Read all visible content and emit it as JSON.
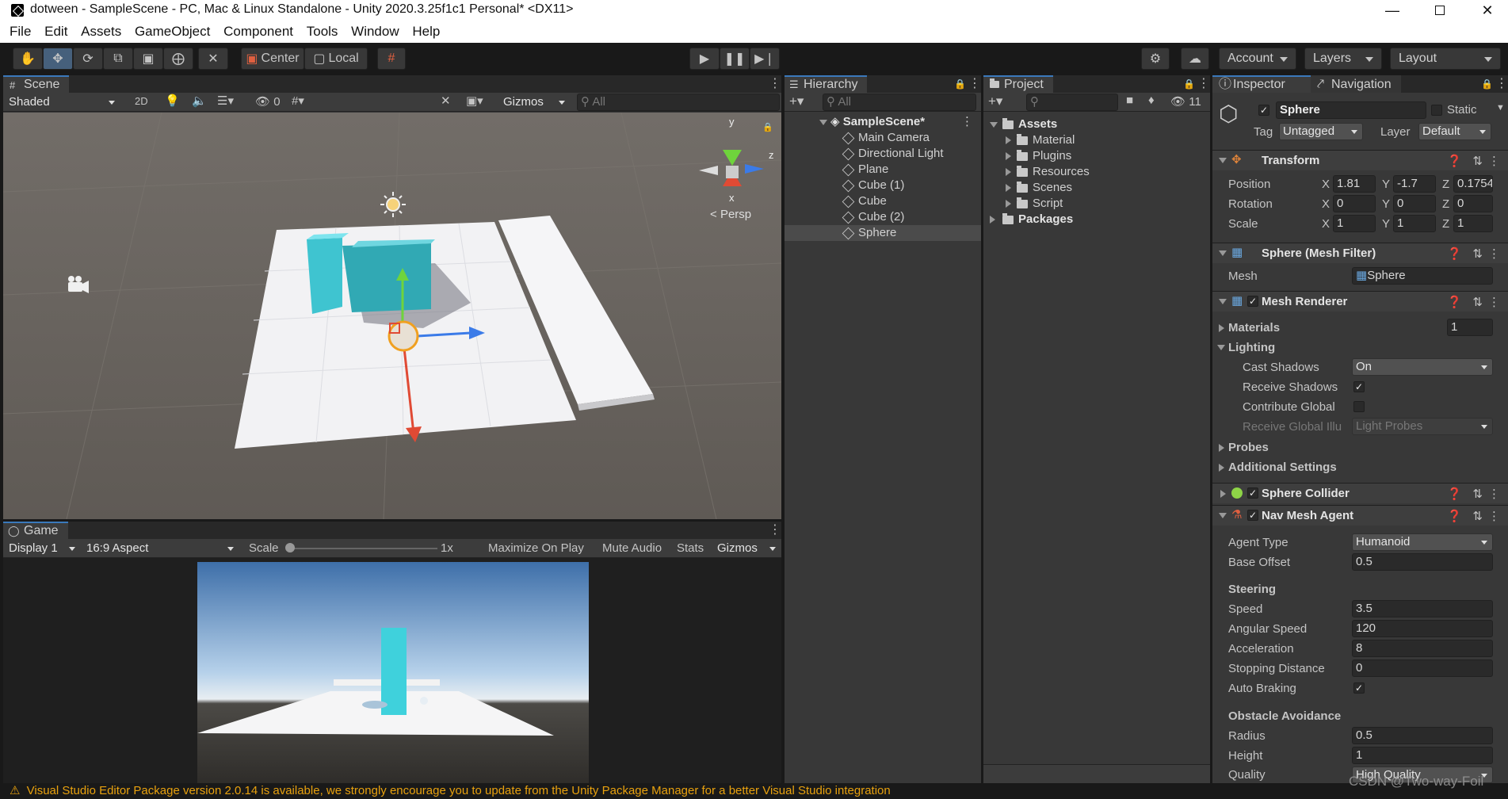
{
  "window": {
    "title": "dotween - SampleScene - PC, Mac & Linux Standalone - Unity 2020.3.25f1c1 Personal* <DX11>"
  },
  "menu": [
    "File",
    "Edit",
    "Assets",
    "GameObject",
    "Component",
    "Tools",
    "Window",
    "Help"
  ],
  "toolbar": {
    "center": "Center",
    "local": "Local",
    "account": "Account",
    "layers": "Layers",
    "layout": "Layout"
  },
  "scene": {
    "tab": "Scene",
    "shading": "Shaded",
    "mode2d": "2D",
    "hidden_count": "0",
    "gizmos": "Gizmos",
    "search_placeholder": "All",
    "persp": "Persp",
    "axes": {
      "x": "x",
      "y": "y",
      "z": "z"
    }
  },
  "game": {
    "tab": "Game",
    "display": "Display 1",
    "aspect": "16:9 Aspect",
    "scale_label": "Scale",
    "scale_value": "1x",
    "maximize": "Maximize On Play",
    "mute": "Mute Audio",
    "stats": "Stats",
    "gizmos": "Gizmos"
  },
  "hierarchy": {
    "tab": "Hierarchy",
    "search_placeholder": "All",
    "scene": "SampleScene*",
    "items": [
      "Main Camera",
      "Directional Light",
      "Plane",
      "Cube (1)",
      "Cube",
      "Cube (2)",
      "Sphere"
    ]
  },
  "project": {
    "tab": "Project",
    "hidden_count": "11",
    "assets": "Assets",
    "folders": [
      "Material",
      "Plugins",
      "Resources",
      "Scenes",
      "Script"
    ],
    "packages": "Packages"
  },
  "inspector": {
    "tab": "Inspector",
    "tab2": "Navigation",
    "object_name": "Sphere",
    "static": "Static",
    "tag_label": "Tag",
    "tag": "Untagged",
    "layer_label": "Layer",
    "layer": "Default",
    "transform": {
      "title": "Transform",
      "position_label": "Position",
      "position": {
        "x": "1.81",
        "y": "-1.7",
        "z": "0.1754"
      },
      "rotation_label": "Rotation",
      "rotation": {
        "x": "0",
        "y": "0",
        "z": "0"
      },
      "scale_label": "Scale",
      "scale": {
        "x": "1",
        "y": "1",
        "z": "1"
      }
    },
    "mesh_filter": {
      "title": "Sphere (Mesh Filter)",
      "mesh_label": "Mesh",
      "mesh": "Sphere"
    },
    "mesh_renderer": {
      "title": "Mesh Renderer",
      "materials_label": "Materials",
      "materials": "1",
      "lighting_label": "Lighting",
      "cast_shadows_label": "Cast Shadows",
      "cast_shadows": "On",
      "receive_shadows_label": "Receive Shadows",
      "contribute_gi_label": "Contribute Global",
      "receive_gi_label": "Receive Global Illu",
      "receive_gi": "Light Probes",
      "probes_label": "Probes",
      "additional_label": "Additional Settings"
    },
    "sphere_collider": {
      "title": "Sphere Collider"
    },
    "nav_mesh_agent": {
      "title": "Nav Mesh Agent",
      "agent_type_label": "Agent Type",
      "agent_type": "Humanoid",
      "base_offset_label": "Base Offset",
      "base_offset": "0.5",
      "steering_label": "Steering",
      "speed_label": "Speed",
      "speed": "3.5",
      "angular_speed_label": "Angular Speed",
      "angular_speed": "120",
      "acceleration_label": "Acceleration",
      "acceleration": "8",
      "stopping_distance_label": "Stopping Distance",
      "stopping_distance": "0",
      "auto_braking_label": "Auto Braking",
      "obstacle_label": "Obstacle Avoidance",
      "radius_label": "Radius",
      "radius": "0.5",
      "height_label": "Height",
      "height": "1",
      "quality_label": "Quality",
      "quality": "High Quality"
    }
  },
  "status": {
    "message": "Visual Studio Editor Package version 2.0.14 is available, we strongly encourage you to update from the Unity Package Manager for a better Visual Studio integration"
  },
  "watermark": "CSDN @Two-way-Foil",
  "colors": {
    "accent": "#3a79bb",
    "warning": "#e8a10e",
    "cube": "#3fc4d0",
    "ground": "#6e6862"
  }
}
